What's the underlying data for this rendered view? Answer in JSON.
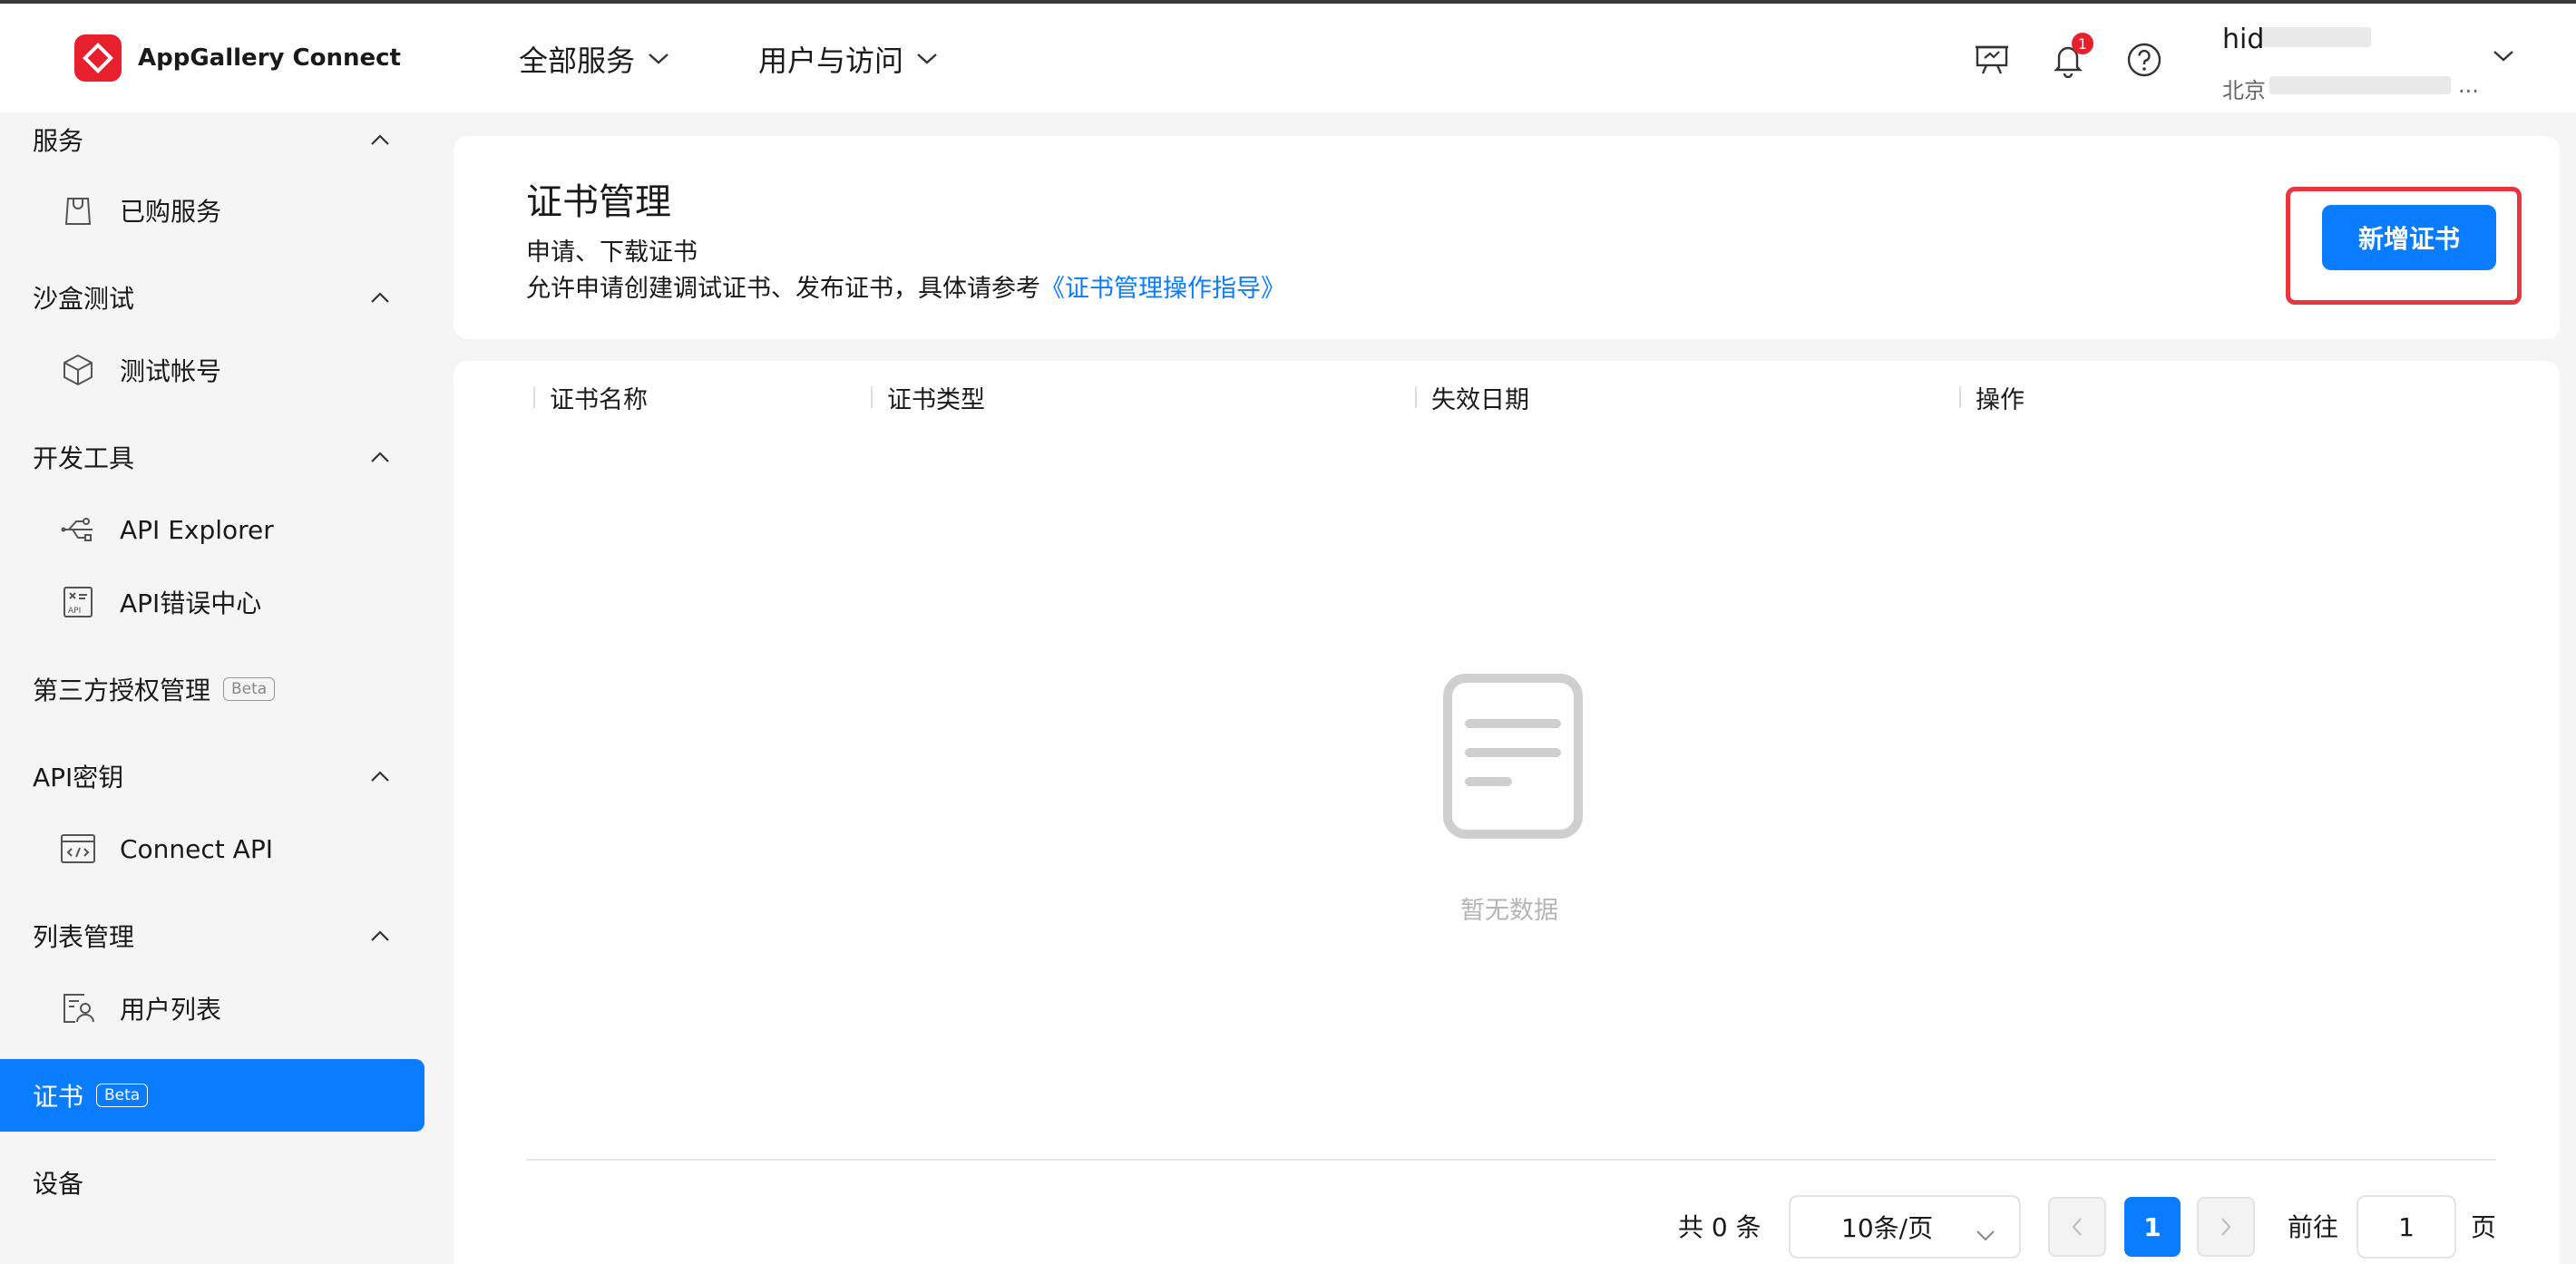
{
  "app": {
    "name": "AppGallery Connect"
  },
  "header": {
    "nav": [
      {
        "label": "全部服务"
      },
      {
        "label": "用户与访问"
      }
    ],
    "notification_count": "1",
    "user": {
      "name": "hid",
      "org": "北京",
      "org_ellipsis": "..."
    }
  },
  "sidebar": {
    "groups": [
      {
        "label": "服务",
        "items": [
          {
            "label": "已购服务",
            "icon": "shopping-bag-icon"
          }
        ]
      },
      {
        "label": "沙盒测试",
        "items": [
          {
            "label": "测试帐号",
            "icon": "cube-icon"
          }
        ]
      },
      {
        "label": "开发工具",
        "items": [
          {
            "label": "API Explorer",
            "icon": "usb-icon"
          },
          {
            "label": "API错误中心",
            "icon": "api-error-icon"
          }
        ]
      },
      {
        "label": "第三方授权管理",
        "badge": "Beta"
      },
      {
        "label": "API密钥",
        "items": [
          {
            "label": "Connect API",
            "icon": "code-window-icon"
          }
        ]
      },
      {
        "label": "列表管理",
        "items": [
          {
            "label": "用户列表",
            "icon": "user-list-icon"
          }
        ]
      }
    ],
    "active": {
      "label": "证书",
      "badge": "Beta"
    },
    "last": {
      "label": "设备"
    }
  },
  "page": {
    "title": "证书管理",
    "desc1": "申请、下载证书",
    "desc2_prefix": "允许申请创建调试证书、发布证书，具体请参考",
    "desc2_link": "《证书管理操作指导》",
    "add_button": "新增证书"
  },
  "table": {
    "columns": [
      "证书名称",
      "证书类型",
      "失效日期",
      "操作"
    ],
    "rows": [],
    "empty_text": "暂无数据"
  },
  "pagination": {
    "total_text": "共 0 条",
    "page_size": "10条/页",
    "current_page": "1",
    "goto_label": "前往",
    "goto_value": "1",
    "page_unit": "页"
  },
  "colors": {
    "primary": "#0a7cff",
    "brand_red": "#e8202e",
    "highlight": "#e8363e"
  }
}
